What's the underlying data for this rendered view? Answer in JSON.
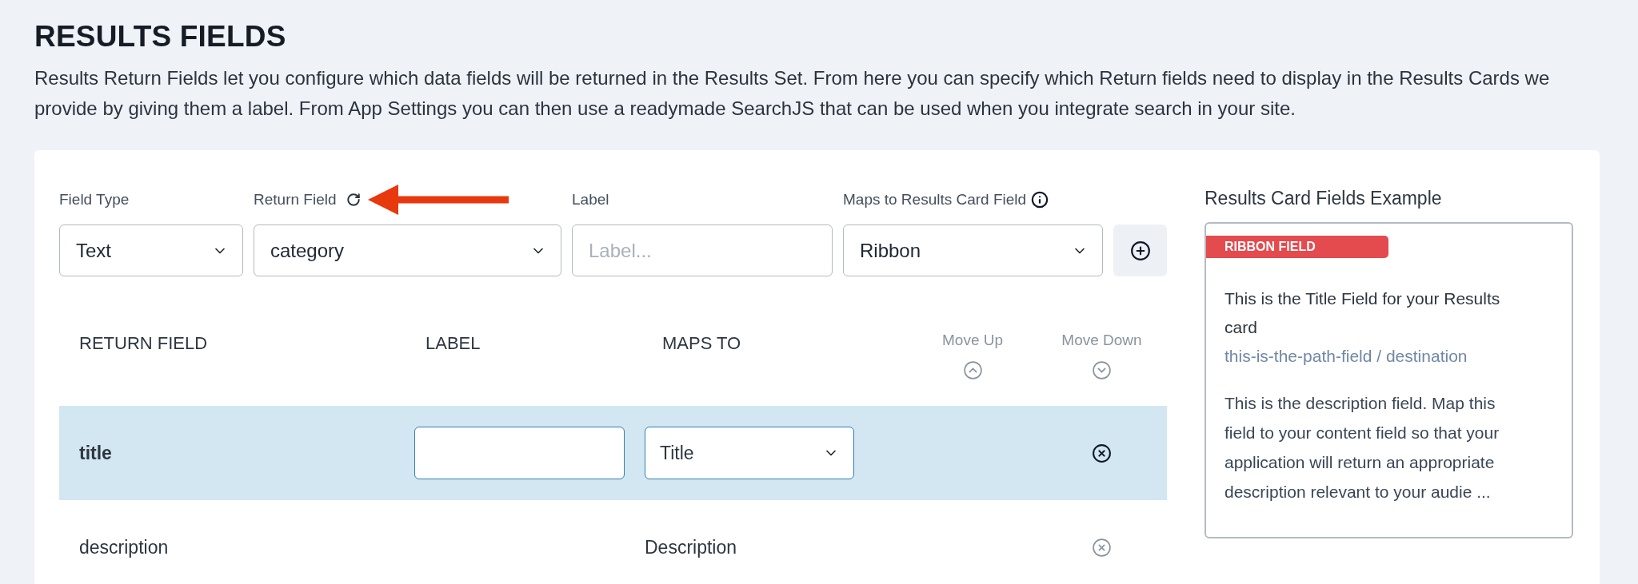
{
  "page": {
    "title": "RESULTS FIELDS",
    "description": "Results Return Fields let you configure which data fields will be returned in the Results Set. From here you can specify which Return fields need to display in the Results Cards we provide by giving them a label. From App Settings you can then use a readymade SearchJS that can be used when you integrate search in your site."
  },
  "form": {
    "fields": [
      {
        "kind": "select",
        "label": "Field Type",
        "value": "Text"
      },
      {
        "kind": "select",
        "label": "Return Field",
        "value": "category"
      },
      {
        "kind": "input",
        "label": "Label",
        "placeholder": "Label..."
      },
      {
        "kind": "select",
        "label": "Maps to Results Card Field",
        "value": "Ribbon"
      }
    ]
  },
  "table": {
    "columns": [
      {
        "kind": "text",
        "label": "RETURN FIELD"
      },
      {
        "kind": "text",
        "label": "LABEL"
      },
      {
        "kind": "text",
        "label": "MAPS TO"
      },
      {
        "kind": "move-up",
        "label": "Move Up"
      },
      {
        "kind": "move-down",
        "label": "Move Down"
      }
    ],
    "rows": [
      {
        "return_field": "title",
        "maps_to": "Title",
        "selected": true
      },
      {
        "return_field": "description",
        "maps_to": "Description",
        "selected": false
      }
    ]
  },
  "preview": {
    "heading": "Results Card Fields Example",
    "ribbon": "RIBBON FIELD",
    "title": "This is the Title Field for your Results card",
    "path": "this-is-the-path-field / destination",
    "description": "This is the description field. Map this field to your content field so that your application will return an appropriate description relevant to your audie ..."
  }
}
